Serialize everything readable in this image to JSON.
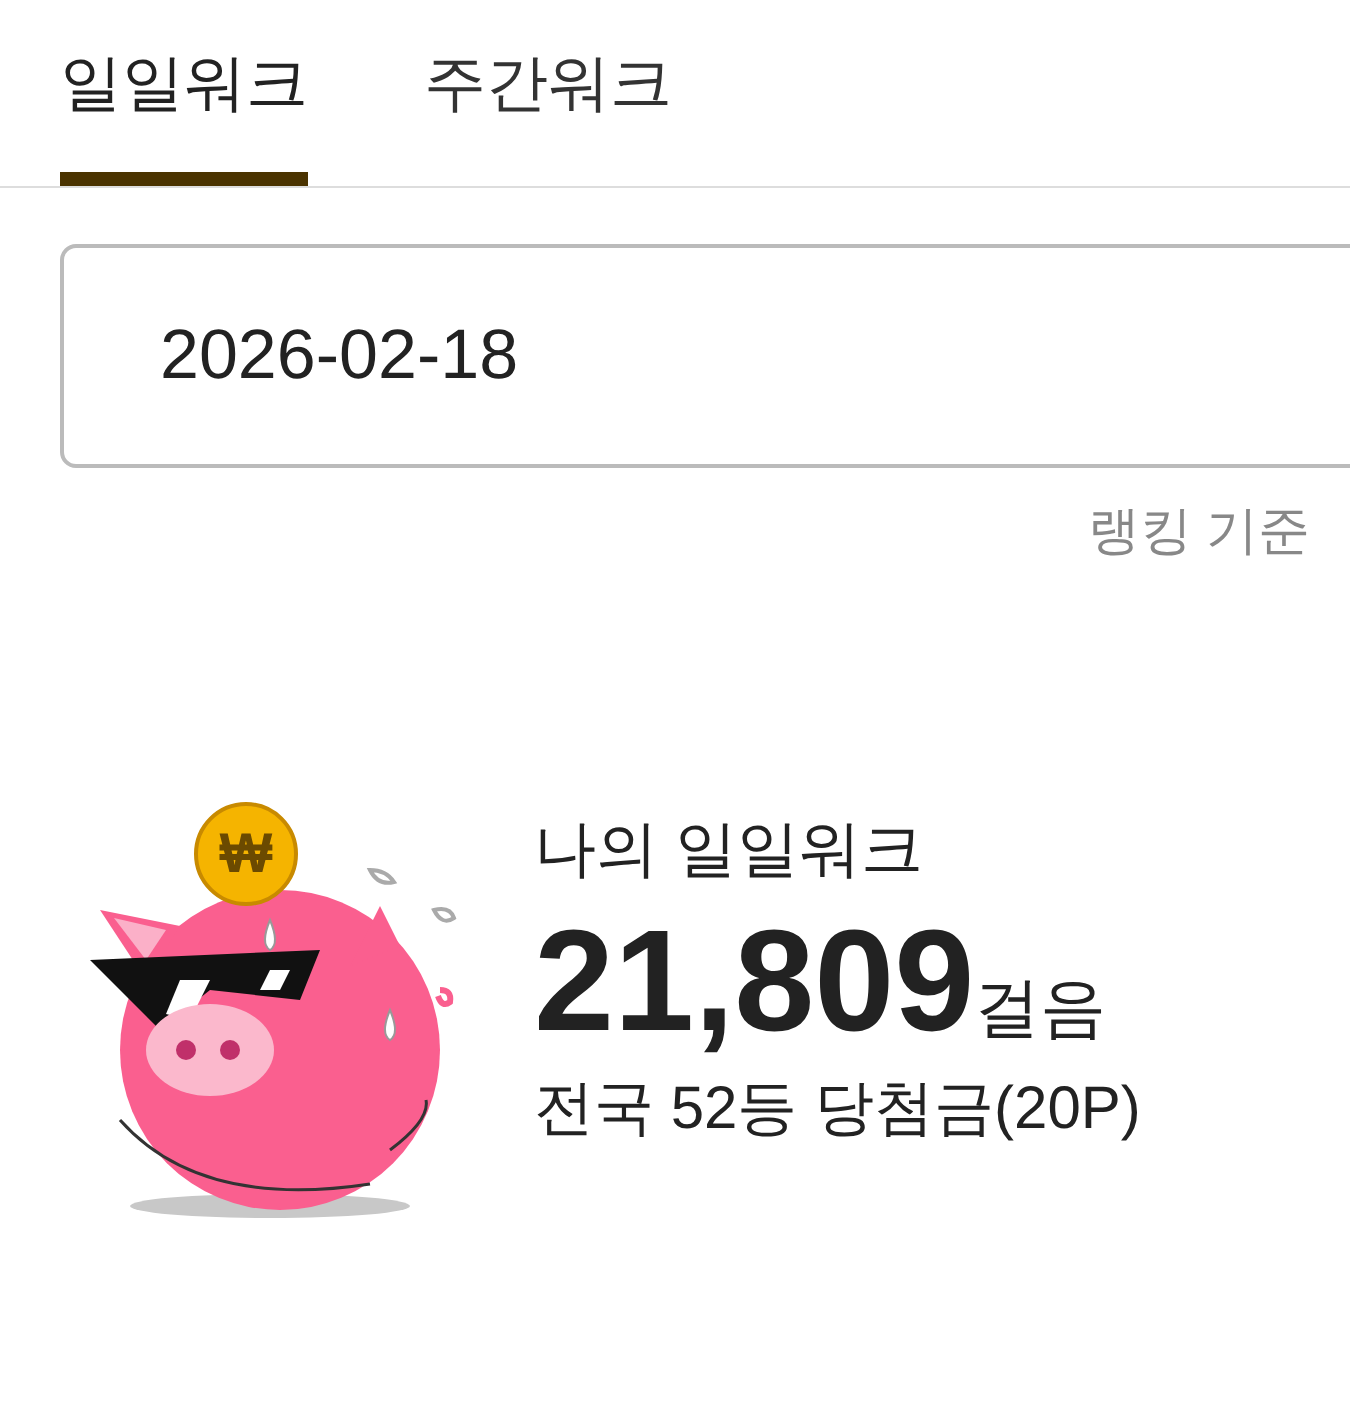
{
  "tabs": [
    {
      "label": "일일워크",
      "selected": true
    },
    {
      "label": "주간워크",
      "selected": false
    }
  ],
  "date_field": {
    "value": "2026-02-18"
  },
  "ranking_note": "랭킹 기준",
  "coin_symbol": "₩",
  "summary": {
    "title": "나의 일일워크",
    "steps": "21,809",
    "unit": "걸음",
    "rank": "전국 52등 당첨금(20P)"
  }
}
